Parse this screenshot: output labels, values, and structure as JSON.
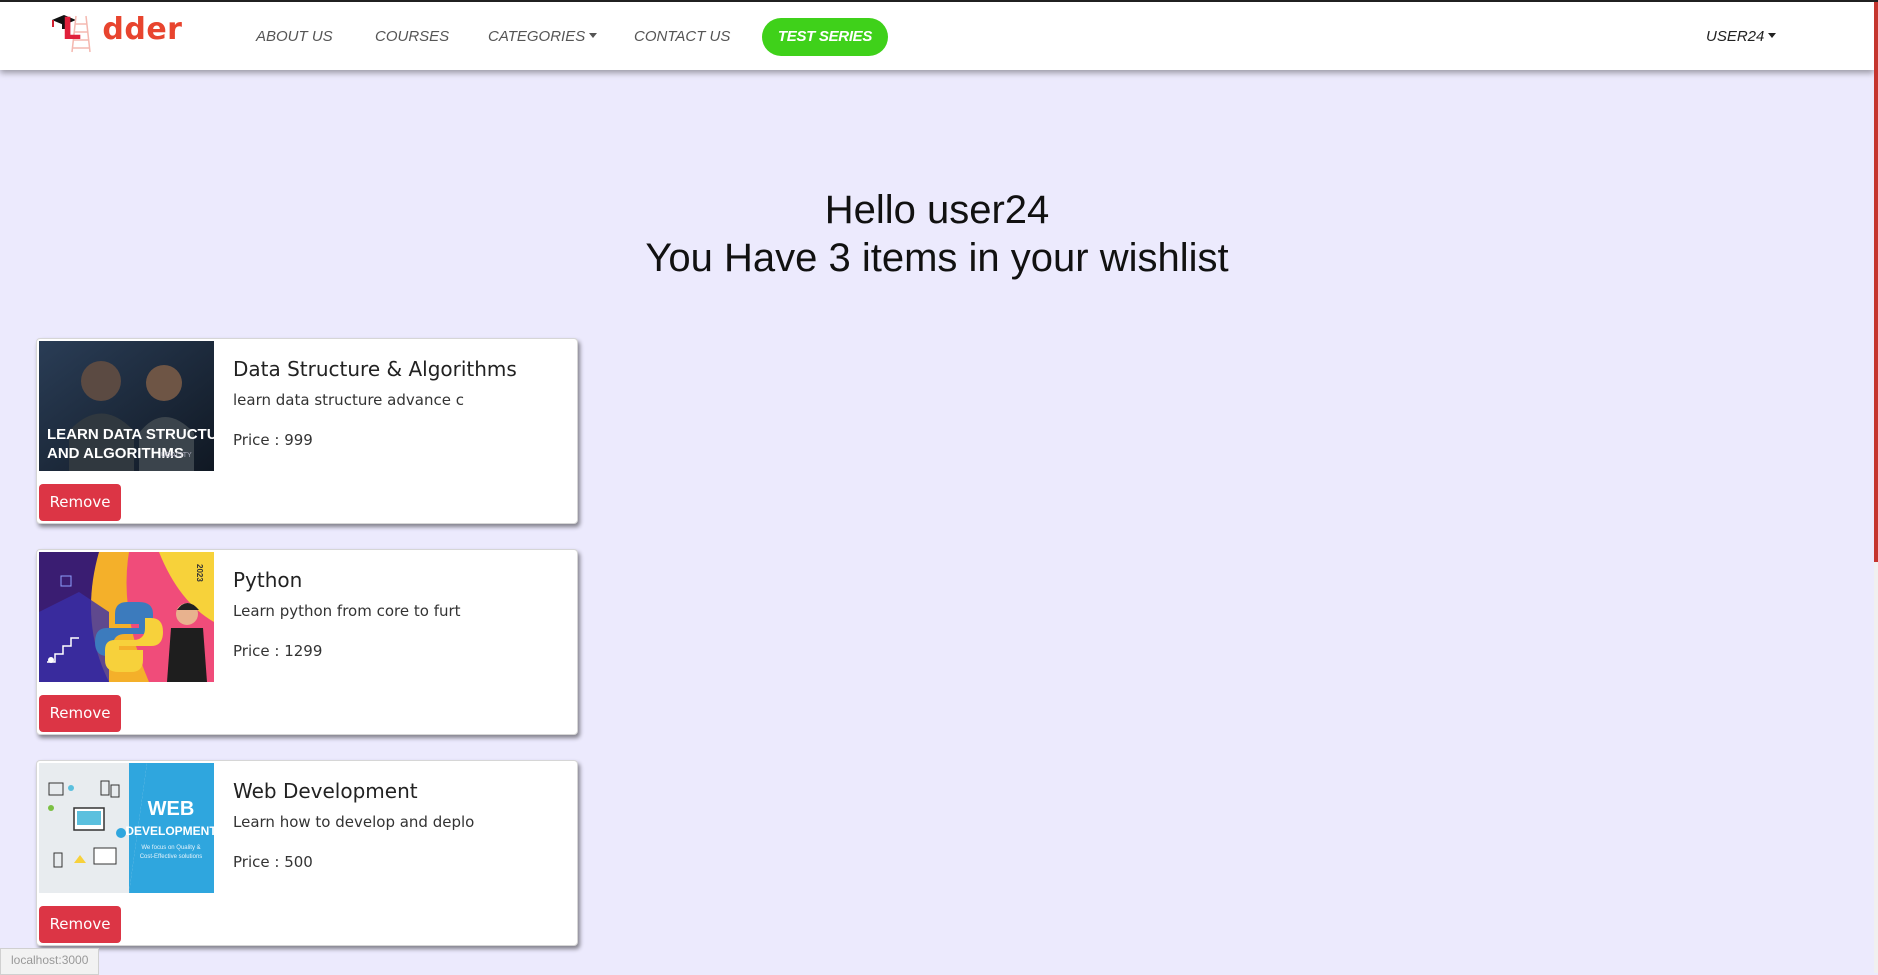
{
  "brand": {
    "logo_text": "Ladder",
    "colors": {
      "l": "#e0203b",
      "a": "#f6a7a0",
      "dder": "#e8442e"
    }
  },
  "nav": {
    "links": [
      "ABOUT US",
      "COURSES",
      "CATEGORIES",
      "CONTACT US"
    ],
    "test_series": "TEST SERIES",
    "user": "USER24",
    "accent": "#3fd11a"
  },
  "wishlist": {
    "greeting": "Hello user24",
    "summary": "You Have 3 items in your wishlist",
    "price_label": "Price : ",
    "remove_label": "Remove",
    "items": [
      {
        "title": "Data Structure & Algorithms",
        "desc": "learn data structure advance c",
        "price": "999",
        "thumb_text": [
          "LEARN DATA STRUCTURES",
          "AND ALGORITHMS"
        ],
        "thumb_badge": "UDACITY"
      },
      {
        "title": "Python",
        "desc": "Learn python from core to furt",
        "price": "1299",
        "thumb_badge": "2023"
      },
      {
        "title": "Web Development",
        "desc": "Learn how to develop and deplo",
        "price": "500",
        "thumb_text": [
          "WEB",
          "DEVELOPMENT",
          "We focus on Quality &",
          "Cost-Effective solutions"
        ]
      }
    ]
  },
  "status_bar": {
    "url": "localhost:3000"
  }
}
